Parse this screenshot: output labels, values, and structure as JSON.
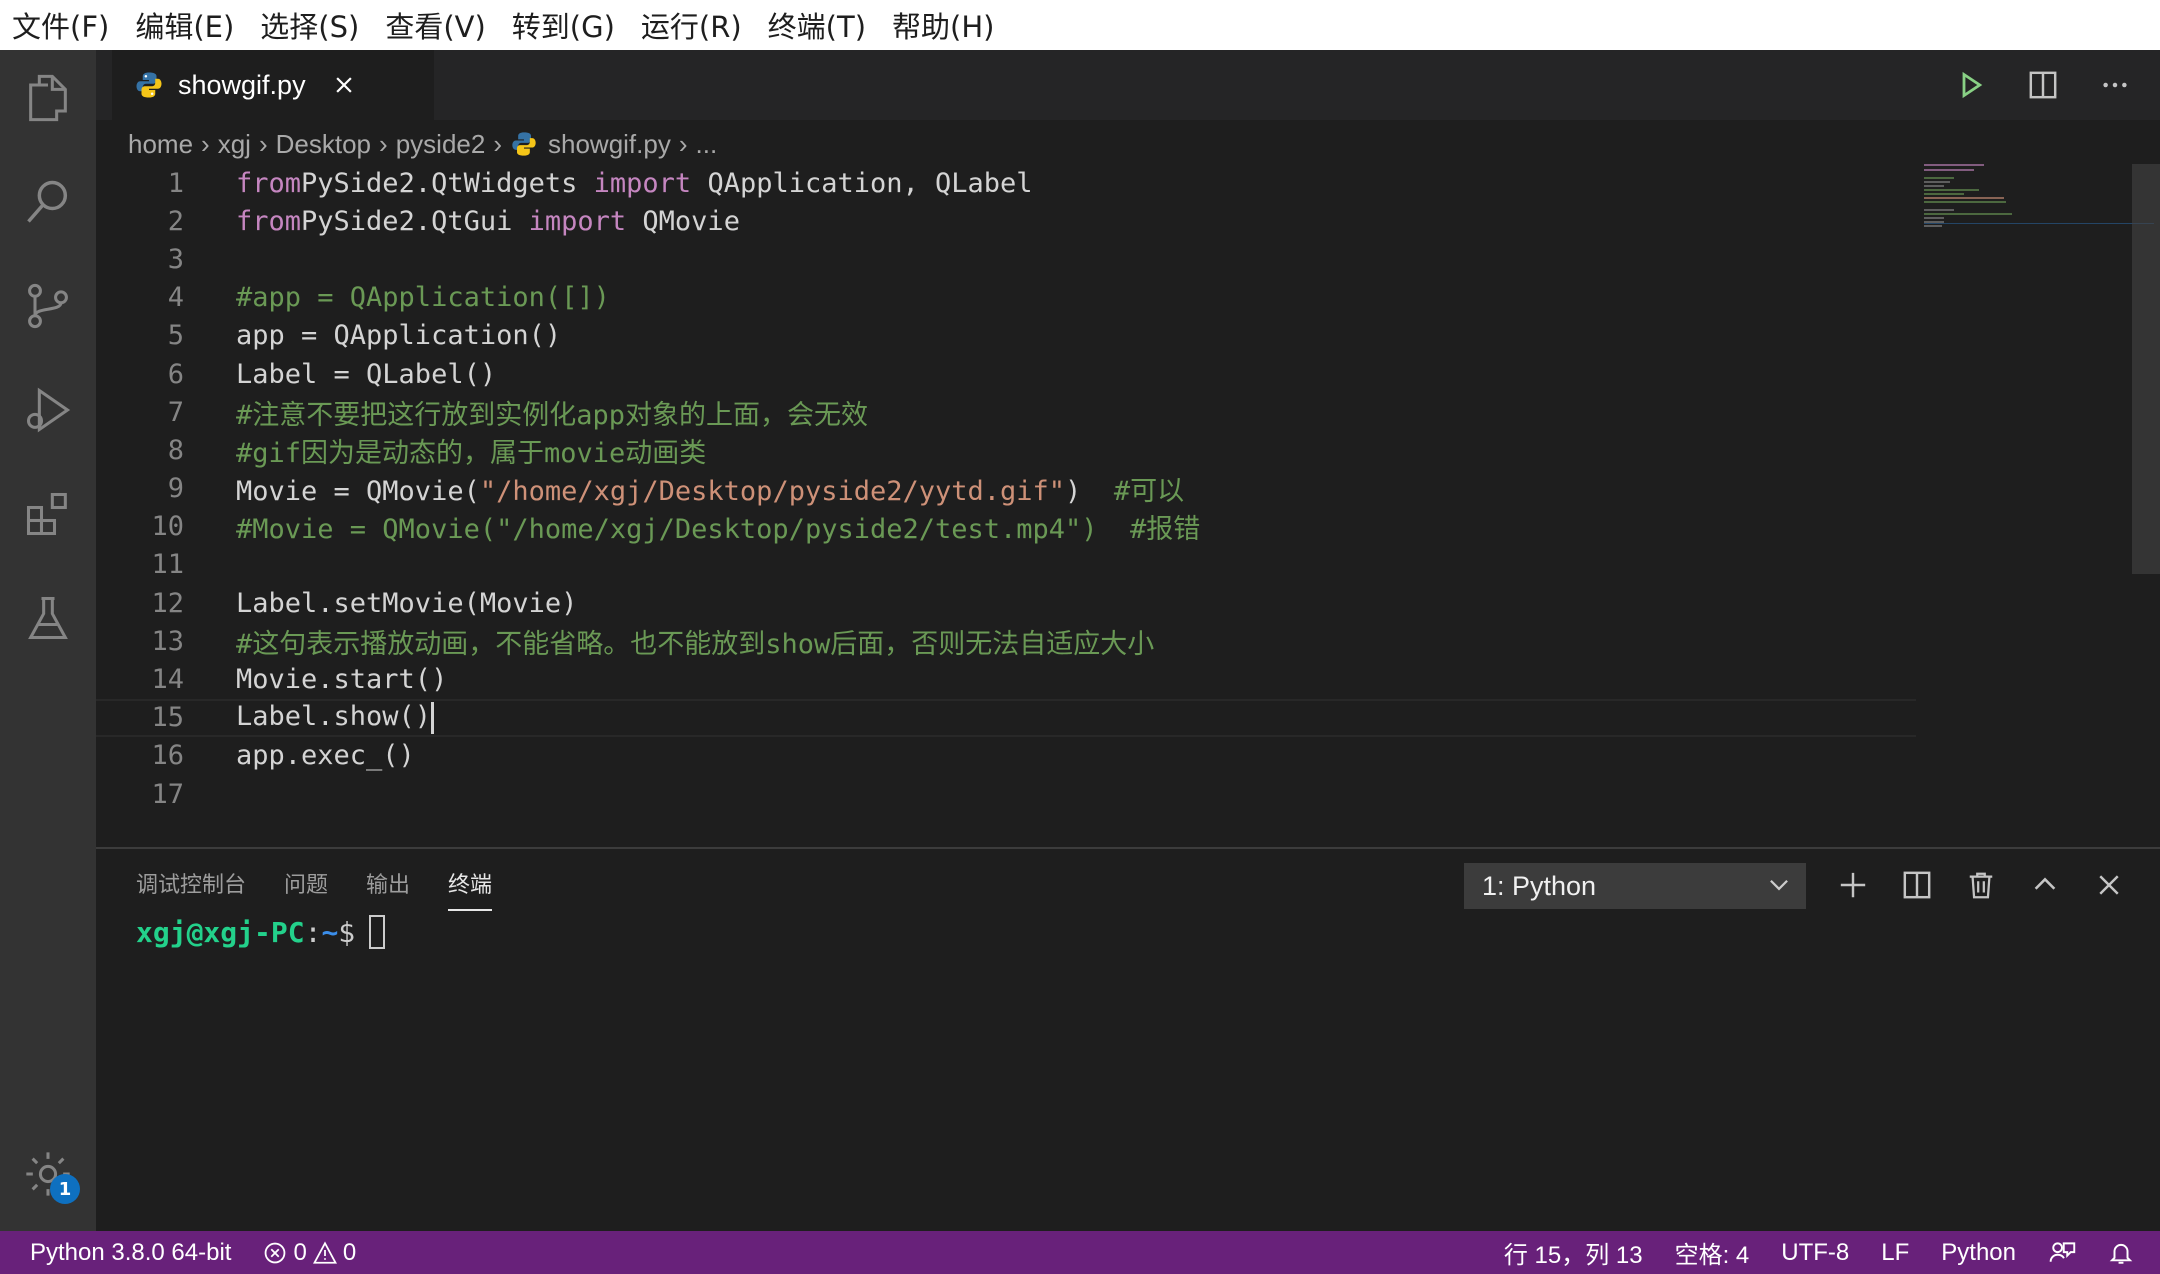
{
  "menu": [
    "文件(F)",
    "编辑(E)",
    "选择(S)",
    "查看(V)",
    "转到(G)",
    "运行(R)",
    "终端(T)",
    "帮助(H)"
  ],
  "tab": {
    "label": "showgif.py"
  },
  "breadcrumb": [
    "home",
    "xgj",
    "Desktop",
    "pyside2",
    "showgif.py",
    "..."
  ],
  "code": [
    {
      "n": "1",
      "parts": [
        [
          "kw",
          "from"
        ],
        [
          "",
          "PySide2.QtWidgets "
        ],
        [
          "kw",
          "import"
        ],
        [
          "",
          " QApplication, QLabel"
        ]
      ]
    },
    {
      "n": "2",
      "parts": [
        [
          "kw",
          "from"
        ],
        [
          "",
          "PySide2.QtGui "
        ],
        [
          "kw",
          "import"
        ],
        [
          "",
          " QMovie"
        ]
      ]
    },
    {
      "n": "3",
      "parts": []
    },
    {
      "n": "4",
      "parts": [
        [
          "cm",
          "#app = QApplication([])"
        ]
      ]
    },
    {
      "n": "5",
      "parts": [
        [
          "",
          "app = QApplication()"
        ]
      ]
    },
    {
      "n": "6",
      "parts": [
        [
          "",
          "Label = QLabel()"
        ]
      ]
    },
    {
      "n": "7",
      "parts": [
        [
          "cm",
          "#注意不要把这行放到实例化app对象的上面，会无效"
        ]
      ]
    },
    {
      "n": "8",
      "parts": [
        [
          "cm",
          "#gif因为是动态的，属于movie动画类"
        ]
      ]
    },
    {
      "n": "9",
      "parts": [
        [
          "",
          "Movie = QMovie("
        ],
        [
          "st",
          "\"/home/xgj/Desktop/pyside2/yytd.gif\""
        ],
        [
          "",
          ")  "
        ],
        [
          "cm",
          "#可以"
        ]
      ]
    },
    {
      "n": "10",
      "parts": [
        [
          "cm",
          "#Movie = QMovie(\"/home/xgj/Desktop/pyside2/test.mp4\")  #报错"
        ]
      ]
    },
    {
      "n": "11",
      "parts": []
    },
    {
      "n": "12",
      "parts": [
        [
          "",
          "Label.setMovie(Movie)"
        ]
      ]
    },
    {
      "n": "13",
      "parts": [
        [
          "cm",
          "#这句表示播放动画，不能省略。也不能放到show后面，否则无法自适应大小"
        ]
      ]
    },
    {
      "n": "14",
      "parts": [
        [
          "",
          "Movie.start()"
        ]
      ]
    },
    {
      "n": "15",
      "parts": [
        [
          "",
          "Label.show()"
        ]
      ]
    },
    {
      "n": "16",
      "parts": [
        [
          "",
          "app.exec_()"
        ]
      ]
    },
    {
      "n": "17",
      "parts": []
    }
  ],
  "panel": {
    "tabs": [
      "调试控制台",
      "问题",
      "输出",
      "终端"
    ],
    "active_tab": "终端",
    "terminal_select": "1: Python",
    "prompt": {
      "user": "xgj@xgj-PC",
      "colon": ":",
      "path": "~",
      "dollar": "$"
    }
  },
  "status": {
    "interpreter": "Python 3.8.0 64-bit",
    "errors": "0",
    "warnings": "0",
    "position": "行 15，列 13",
    "spaces": "空格: 4",
    "encoding": "UTF-8",
    "eol": "LF",
    "language": "Python"
  },
  "settings_badge": "1",
  "colors": {
    "statusbar": "#68217a",
    "keyword": "#c586c0",
    "comment": "#6a9955",
    "string": "#ce9178"
  }
}
